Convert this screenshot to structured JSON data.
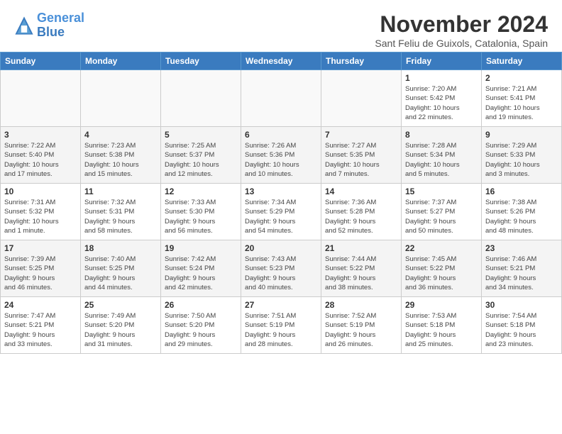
{
  "header": {
    "logo_line1": "General",
    "logo_line2": "Blue",
    "month_title": "November 2024",
    "location": "Sant Feliu de Guixols, Catalonia, Spain"
  },
  "weekdays": [
    "Sunday",
    "Monday",
    "Tuesday",
    "Wednesday",
    "Thursday",
    "Friday",
    "Saturday"
  ],
  "weeks": [
    [
      {
        "day": "",
        "info": ""
      },
      {
        "day": "",
        "info": ""
      },
      {
        "day": "",
        "info": ""
      },
      {
        "day": "",
        "info": ""
      },
      {
        "day": "",
        "info": ""
      },
      {
        "day": "1",
        "info": "Sunrise: 7:20 AM\nSunset: 5:42 PM\nDaylight: 10 hours\nand 22 minutes."
      },
      {
        "day": "2",
        "info": "Sunrise: 7:21 AM\nSunset: 5:41 PM\nDaylight: 10 hours\nand 19 minutes."
      }
    ],
    [
      {
        "day": "3",
        "info": "Sunrise: 7:22 AM\nSunset: 5:40 PM\nDaylight: 10 hours\nand 17 minutes."
      },
      {
        "day": "4",
        "info": "Sunrise: 7:23 AM\nSunset: 5:38 PM\nDaylight: 10 hours\nand 15 minutes."
      },
      {
        "day": "5",
        "info": "Sunrise: 7:25 AM\nSunset: 5:37 PM\nDaylight: 10 hours\nand 12 minutes."
      },
      {
        "day": "6",
        "info": "Sunrise: 7:26 AM\nSunset: 5:36 PM\nDaylight: 10 hours\nand 10 minutes."
      },
      {
        "day": "7",
        "info": "Sunrise: 7:27 AM\nSunset: 5:35 PM\nDaylight: 10 hours\nand 7 minutes."
      },
      {
        "day": "8",
        "info": "Sunrise: 7:28 AM\nSunset: 5:34 PM\nDaylight: 10 hours\nand 5 minutes."
      },
      {
        "day": "9",
        "info": "Sunrise: 7:29 AM\nSunset: 5:33 PM\nDaylight: 10 hours\nand 3 minutes."
      }
    ],
    [
      {
        "day": "10",
        "info": "Sunrise: 7:31 AM\nSunset: 5:32 PM\nDaylight: 10 hours\nand 1 minute."
      },
      {
        "day": "11",
        "info": "Sunrise: 7:32 AM\nSunset: 5:31 PM\nDaylight: 9 hours\nand 58 minutes."
      },
      {
        "day": "12",
        "info": "Sunrise: 7:33 AM\nSunset: 5:30 PM\nDaylight: 9 hours\nand 56 minutes."
      },
      {
        "day": "13",
        "info": "Sunrise: 7:34 AM\nSunset: 5:29 PM\nDaylight: 9 hours\nand 54 minutes."
      },
      {
        "day": "14",
        "info": "Sunrise: 7:36 AM\nSunset: 5:28 PM\nDaylight: 9 hours\nand 52 minutes."
      },
      {
        "day": "15",
        "info": "Sunrise: 7:37 AM\nSunset: 5:27 PM\nDaylight: 9 hours\nand 50 minutes."
      },
      {
        "day": "16",
        "info": "Sunrise: 7:38 AM\nSunset: 5:26 PM\nDaylight: 9 hours\nand 48 minutes."
      }
    ],
    [
      {
        "day": "17",
        "info": "Sunrise: 7:39 AM\nSunset: 5:25 PM\nDaylight: 9 hours\nand 46 minutes."
      },
      {
        "day": "18",
        "info": "Sunrise: 7:40 AM\nSunset: 5:25 PM\nDaylight: 9 hours\nand 44 minutes."
      },
      {
        "day": "19",
        "info": "Sunrise: 7:42 AM\nSunset: 5:24 PM\nDaylight: 9 hours\nand 42 minutes."
      },
      {
        "day": "20",
        "info": "Sunrise: 7:43 AM\nSunset: 5:23 PM\nDaylight: 9 hours\nand 40 minutes."
      },
      {
        "day": "21",
        "info": "Sunrise: 7:44 AM\nSunset: 5:22 PM\nDaylight: 9 hours\nand 38 minutes."
      },
      {
        "day": "22",
        "info": "Sunrise: 7:45 AM\nSunset: 5:22 PM\nDaylight: 9 hours\nand 36 minutes."
      },
      {
        "day": "23",
        "info": "Sunrise: 7:46 AM\nSunset: 5:21 PM\nDaylight: 9 hours\nand 34 minutes."
      }
    ],
    [
      {
        "day": "24",
        "info": "Sunrise: 7:47 AM\nSunset: 5:21 PM\nDaylight: 9 hours\nand 33 minutes."
      },
      {
        "day": "25",
        "info": "Sunrise: 7:49 AM\nSunset: 5:20 PM\nDaylight: 9 hours\nand 31 minutes."
      },
      {
        "day": "26",
        "info": "Sunrise: 7:50 AM\nSunset: 5:20 PM\nDaylight: 9 hours\nand 29 minutes."
      },
      {
        "day": "27",
        "info": "Sunrise: 7:51 AM\nSunset: 5:19 PM\nDaylight: 9 hours\nand 28 minutes."
      },
      {
        "day": "28",
        "info": "Sunrise: 7:52 AM\nSunset: 5:19 PM\nDaylight: 9 hours\nand 26 minutes."
      },
      {
        "day": "29",
        "info": "Sunrise: 7:53 AM\nSunset: 5:18 PM\nDaylight: 9 hours\nand 25 minutes."
      },
      {
        "day": "30",
        "info": "Sunrise: 7:54 AM\nSunset: 5:18 PM\nDaylight: 9 hours\nand 23 minutes."
      }
    ]
  ]
}
